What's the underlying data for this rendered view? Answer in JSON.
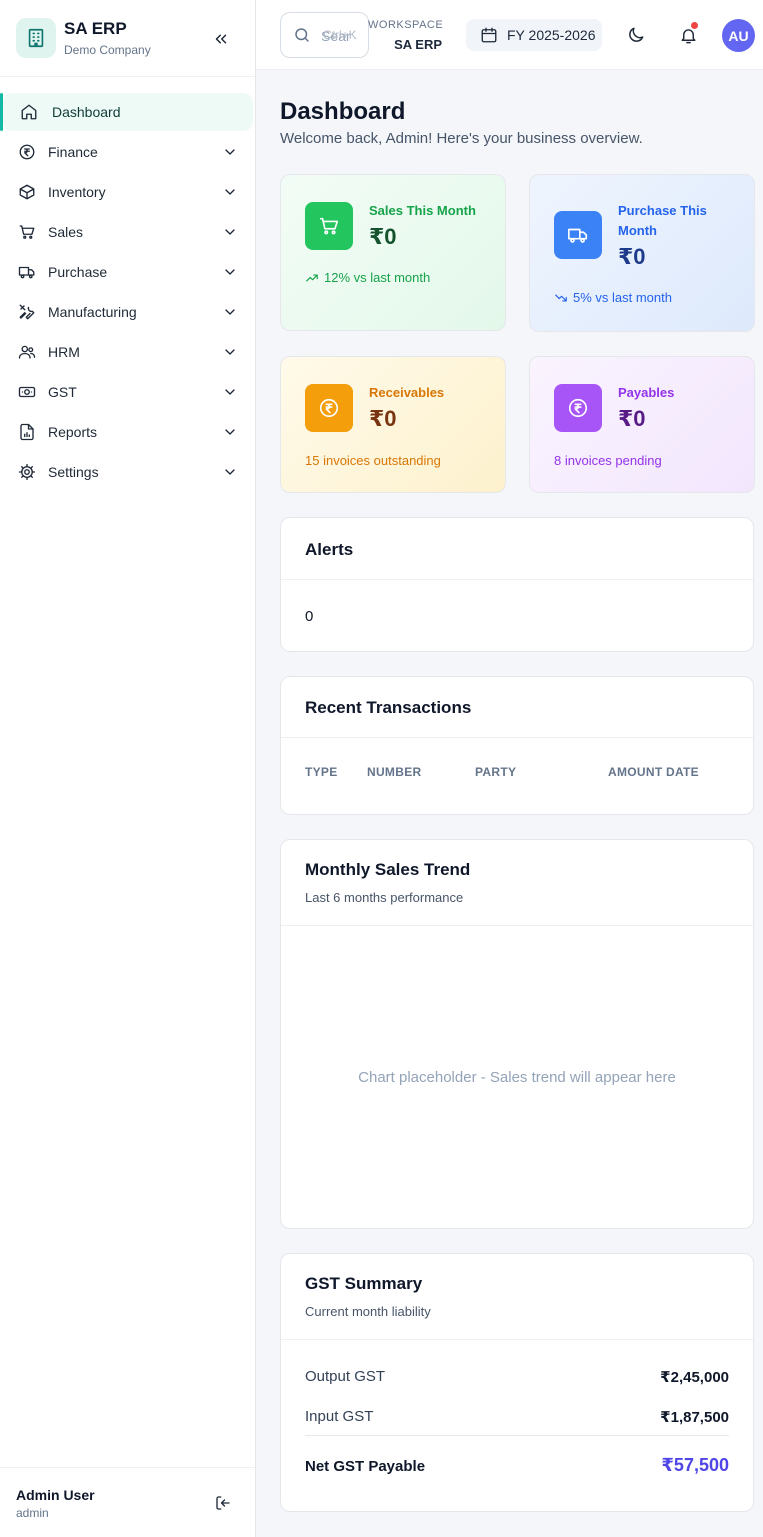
{
  "brand": {
    "name": "SA ERP",
    "company": "Demo Company"
  },
  "sidebar": {
    "items": [
      {
        "label": "Dashboard"
      },
      {
        "label": "Finance"
      },
      {
        "label": "Inventory"
      },
      {
        "label": "Sales"
      },
      {
        "label": "Purchase"
      },
      {
        "label": "Manufacturing"
      },
      {
        "label": "HRM"
      },
      {
        "label": "GST"
      },
      {
        "label": "Reports"
      },
      {
        "label": "Settings"
      }
    ]
  },
  "user": {
    "name": "Admin User",
    "role": "admin",
    "initials": "AU"
  },
  "topbar": {
    "search_placeholder": "Sear",
    "search_shortcut": "Ctrl+K",
    "workspace_label": "WORKSPACE",
    "workspace_name": "SA ERP",
    "fiscal_year": "FY 2025-2026"
  },
  "page": {
    "title": "Dashboard",
    "subtitle": "Welcome back, Admin! Here's your business overview."
  },
  "stats": {
    "sales": {
      "label": "Sales This Month",
      "value": "₹0",
      "foot": "12% vs last month"
    },
    "purchase": {
      "label": "Purchase This Month",
      "value": "₹0",
      "foot": "5% vs last month"
    },
    "receivables": {
      "label": "Receivables",
      "value": "₹0",
      "foot": "15 invoices outstanding"
    },
    "payables": {
      "label": "Payables",
      "value": "₹0",
      "foot": "8 invoices pending"
    }
  },
  "alerts": {
    "title": "Alerts",
    "count": "0"
  },
  "transactions": {
    "title": "Recent Transactions",
    "columns": [
      "TYPE",
      "NUMBER",
      "PARTY",
      "AMOUNT",
      "DATE"
    ]
  },
  "trend": {
    "title": "Monthly Sales Trend",
    "subtitle": "Last 6 months performance",
    "placeholder": "Chart placeholder - Sales trend will appear here"
  },
  "gst": {
    "title": "GST Summary",
    "subtitle": "Current month liability",
    "output_label": "Output GST",
    "output_value": "₹2,45,000",
    "input_label": "Input GST",
    "input_value": "₹1,87,500",
    "net_label": "Net GST Payable",
    "net_value": "₹57,500"
  },
  "colors": {
    "accent_teal": "#14b8a6",
    "sales_green": "#22c55e",
    "purchase_blue": "#3b82f6",
    "receivable_orange": "#f59e0b",
    "payable_purple": "#a855f7",
    "net_indigo": "#4f46e5"
  }
}
